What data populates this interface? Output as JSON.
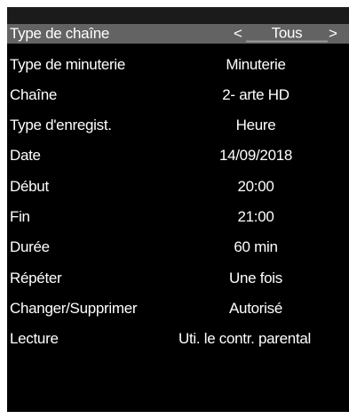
{
  "menu": {
    "selected": {
      "label": "Type de chaîne",
      "value": "Tous",
      "arrow_left": "<",
      "arrow_right": ">"
    },
    "rows": [
      {
        "label": "Type de minuterie",
        "value": "Minuterie"
      },
      {
        "label": "Chaîne",
        "value": "2- arte HD"
      },
      {
        "label": "Type d'enregist.",
        "value": "Heure"
      },
      {
        "label": "Date",
        "value": "14/09/2018"
      },
      {
        "label": "Début",
        "value": "20:00"
      },
      {
        "label": "Fin",
        "value": "21:00"
      },
      {
        "label": "Durée",
        "value": "60 min"
      },
      {
        "label": "Répéter",
        "value": "Une fois"
      },
      {
        "label": "Changer/Supprimer",
        "value": "Autorisé"
      },
      {
        "label": "Lecture",
        "value": "Uti. le contr. parental"
      }
    ]
  },
  "colors": {
    "background": "#000000",
    "selected_row": "#636363",
    "text": "#ffffff"
  }
}
